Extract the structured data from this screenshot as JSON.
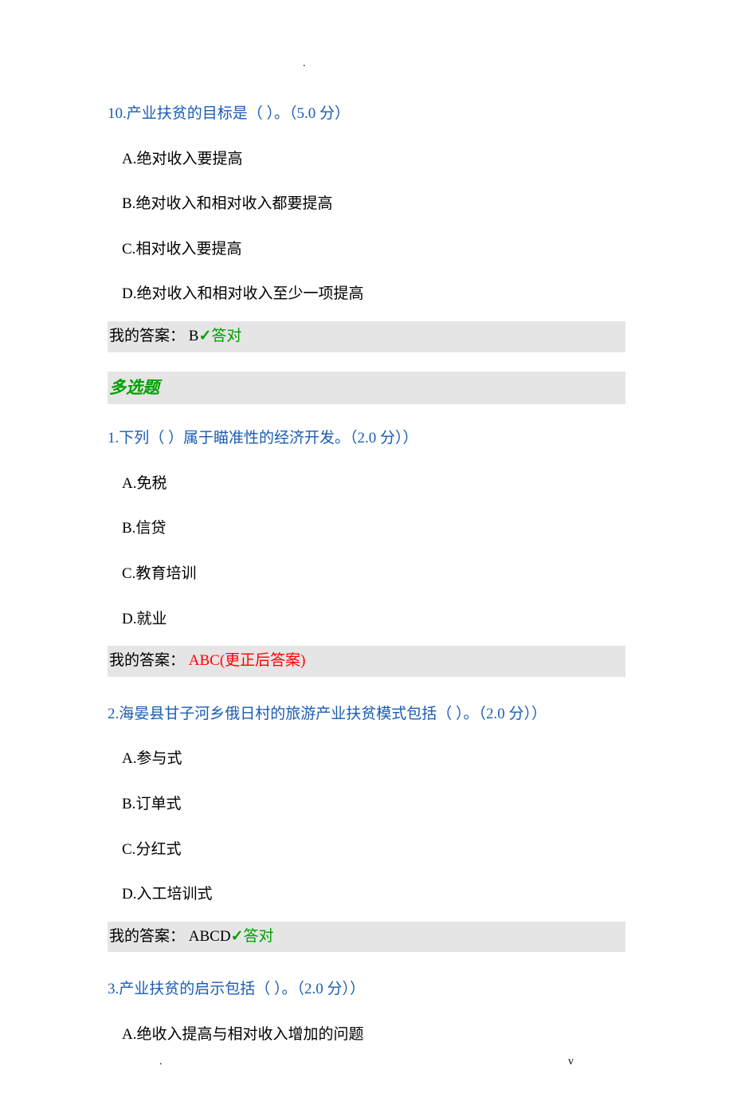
{
  "marks": {
    "top": ".",
    "bottom_left": ".",
    "bottom_right": "v"
  },
  "q10": {
    "num": "10.",
    "title": "产业扶贫的目标是（  ）。（5.0 分）",
    "opts": [
      {
        "letter": "A.",
        "text": "绝对收入要提高"
      },
      {
        "letter": "B.",
        "text": "绝对收入和相对收入都要提高"
      },
      {
        "letter": "C.",
        "text": "相对收入要提高"
      },
      {
        "letter": "D.",
        "text": "绝对收入和相对收入至少一项提高"
      }
    ],
    "ans_label": "我的答案：",
    "ans_value": "B",
    "check": "✓",
    "result": "答对"
  },
  "section_multi": "多选题",
  "mq1": {
    "num": "1.",
    "title": "下列（  ）属于瞄准性的经济开发。（2.0 分））",
    "opts": [
      {
        "letter": "A.",
        "text": "免税"
      },
      {
        "letter": "B.",
        "text": "信贷"
      },
      {
        "letter": "C.",
        "text": "教育培训"
      },
      {
        "letter": "D.",
        "text": "就业"
      }
    ],
    "ans_label": "我的答案：",
    "ans_value": "ABC",
    "note": "(更正后答案)"
  },
  "mq2": {
    "num": "2.",
    "title": "海晏县甘子河乡俄日村的旅游产业扶贫模式包括（  ）。（2.0 分））",
    "opts": [
      {
        "letter": "A.",
        "text": "参与式"
      },
      {
        "letter": "B.",
        "text": "订单式"
      },
      {
        "letter": "C.",
        "text": "分红式"
      },
      {
        "letter": "D.",
        "text": "入工培训式"
      }
    ],
    "ans_label": "我的答案：",
    "ans_value": "ABCD",
    "check": "✓",
    "result": "答对"
  },
  "mq3": {
    "num": "3.",
    "title": "产业扶贫的启示包括（  ）。（2.0 分））",
    "opts": [
      {
        "letter": "A.",
        "text": "绝收入提高与相对收入增加的问题"
      }
    ]
  }
}
